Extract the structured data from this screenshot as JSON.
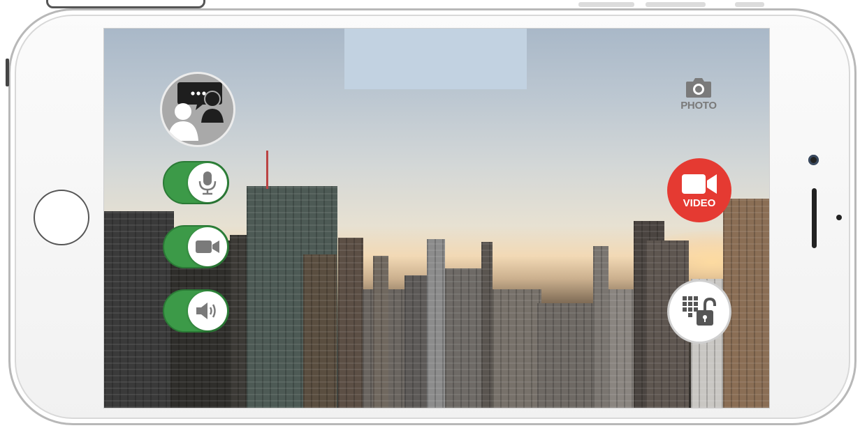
{
  "controls": {
    "photo_label": "PHOTO",
    "video_label": "VIDEO"
  },
  "toggles": [
    {
      "name": "microphone",
      "on": true
    },
    {
      "name": "camera",
      "on": true
    },
    {
      "name": "speaker",
      "on": true
    }
  ],
  "icons": {
    "chat": "chat-bubble-users-icon",
    "mic": "microphone-icon",
    "cam": "video-camera-icon",
    "speaker": "speaker-volume-icon",
    "photo": "camera-icon",
    "video": "video-camera-icon",
    "lock": "keypad-unlock-icon"
  },
  "colors": {
    "toggle_on": "#3c9a48",
    "video_red": "#e53a32",
    "icon_gray": "#7a7a7a"
  }
}
